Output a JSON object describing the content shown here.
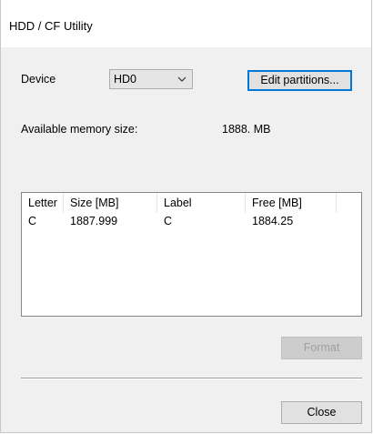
{
  "window": {
    "title": "HDD / CF Utility"
  },
  "device": {
    "label": "Device",
    "selected": "HD0",
    "edit_button": "Edit partitions..."
  },
  "memory": {
    "label": "Available memory size:",
    "value": "1888. MB"
  },
  "partitions": {
    "columns": [
      "Letter",
      "Size [MB]",
      "Label",
      "Free [MB]"
    ],
    "rows": [
      [
        "C",
        "1887.999",
        "C",
        "1884.25"
      ]
    ]
  },
  "buttons": {
    "format": "Format",
    "close": "Close"
  }
}
